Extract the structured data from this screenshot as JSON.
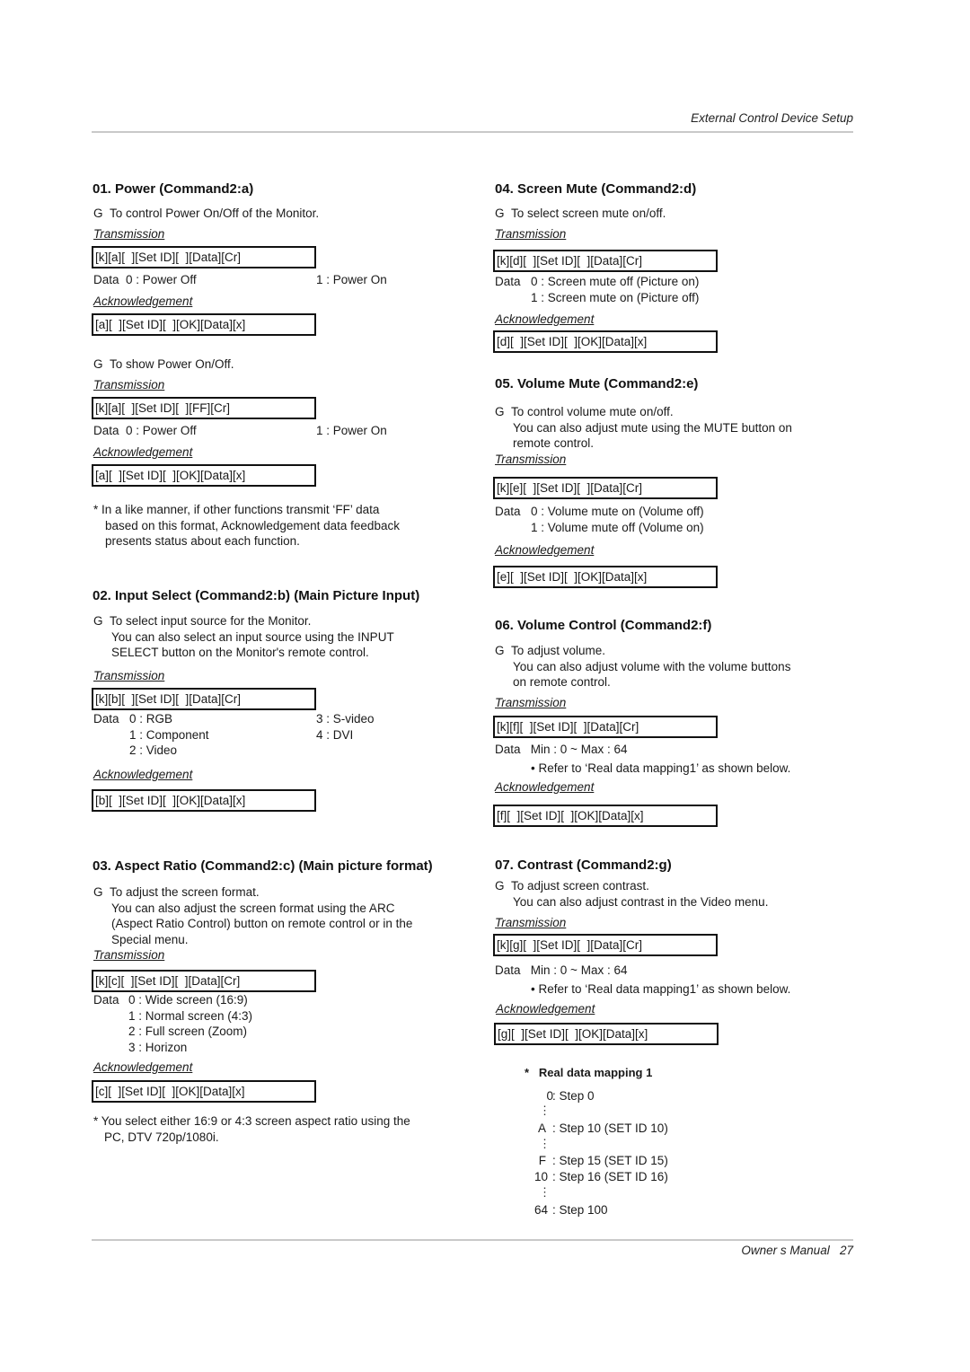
{
  "header": {
    "title": "External Control Device Setup"
  },
  "footer": {
    "label": "Owner s Manual",
    "page": "27"
  },
  "sections": {
    "s01": {
      "title": "01. Power (Command2:a)",
      "part1": {
        "bullet": "G",
        "desc": "To control Power On/Off of the Monitor.",
        "tx_label": "Transmission",
        "tx": "[k][a][  ][Set ID][  ][Data][Cr]",
        "data_label": "Data",
        "d0": "0  : Power Off",
        "d1": "1  : Power On",
        "ack_label": "Acknowledgement",
        "ack": "[a][  ][Set ID][  ][OK][Data][x]"
      },
      "part2": {
        "bullet": "G",
        "desc": "To show Power On/Off.",
        "tx_label": "Transmission",
        "tx": "[k][a][  ][Set ID][  ][FF][Cr]",
        "data_label": "Data",
        "d0": "0  : Power Off",
        "d1": "1  : Power On",
        "ack_label": "Acknowledgement",
        "ack": "[a][  ][Set ID][  ][OK][Data][x]"
      },
      "note": [
        "* In a like manner, if other functions transmit ‘FF’ data",
        "based on this format, Acknowledgement data feedback",
        "presents status about each function."
      ]
    },
    "s02": {
      "title": "02. Input Select (Command2:b) (Main Picture Input)",
      "bullet": "G",
      "desc": [
        "To select input source for the Monitor.",
        "You can also select an input source using the INPUT",
        "SELECT button on the Monitor's remote control."
      ],
      "tx_label": "Transmission",
      "tx": "[k][b][  ][Set ID][  ][Data][Cr]",
      "data_label": "Data",
      "left": [
        "0  : RGB",
        "1  : Component",
        "2  : Video"
      ],
      "right": [
        "3  : S-video",
        "4  : DVI"
      ],
      "ack_label": "Acknowledgement",
      "ack": "[b][  ][Set ID][  ][OK][Data][x]"
    },
    "s03": {
      "title": "03. Aspect Ratio (Command2:c) (Main picture format)",
      "bullet": "G",
      "desc": [
        "To adjust the screen format.",
        "You can also adjust the screen format using the ARC",
        "(Aspect Ratio Control) button on remote control or in the",
        "Special menu."
      ],
      "tx_label": "Transmission",
      "tx": "[k][c][  ][Set ID][  ][Data][Cr]",
      "data_label": "Data",
      "values": [
        "0  :  Wide screen (16:9)",
        "1  :  Normal screen (4:3)",
        "2  :  Full screen (Zoom)",
        "3  :  Horizon"
      ],
      "ack_label": "Acknowledgement",
      "ack": "[c][  ][Set ID][  ][OK][Data][x]",
      "note": [
        "* You select either 16:9 or 4:3 screen aspect ratio using the",
        "PC, DTV 720p/1080i."
      ]
    },
    "s04": {
      "title": "04. Screen Mute (Command2:d)",
      "bullet": "G",
      "desc": "To select screen mute on/off.",
      "tx_label": "Transmission",
      "tx": "[k][d][  ][Set ID][  ][Data][Cr]",
      "data_label": "Data",
      "values": [
        "0  :  Screen mute off (Picture on)",
        "1  :  Screen mute on (Picture off)"
      ],
      "ack_label": "Acknowledgement",
      "ack": "[d][  ][Set ID][  ][OK][Data][x]"
    },
    "s05": {
      "title": "05. Volume Mute (Command2:e)",
      "bullet": "G",
      "desc": [
        "To control volume mute on/off.",
        "You can also adjust mute using the MUTE button on",
        "remote control."
      ],
      "tx_label": "Transmission",
      "tx": "[k][e][  ][Set ID][  ][Data][Cr]",
      "data_label": "Data",
      "values": [
        "0  :  Volume mute on (Volume off)",
        "1  :  Volume mute off (Volume on)"
      ],
      "ack_label": "Acknowledgement",
      "ack": "[e][  ][Set ID][  ][OK][Data][x]"
    },
    "s06": {
      "title": "06. Volume Control (Command2:f)",
      "bullet": "G",
      "desc": [
        "To adjust volume.",
        "You can also adjust volume with the volume buttons",
        "on remote control."
      ],
      "tx_label": "Transmission",
      "tx": "[k][f][  ][Set ID][  ][Data][Cr]",
      "data_label": "Data",
      "range": "Min : 0 ~ Max : 64",
      "refer": "• Refer to ‘Real data mapping1’ as shown below.",
      "ack_label": "Acknowledgement",
      "ack": "[f][  ][Set ID][  ][OK][Data][x]"
    },
    "s07": {
      "title": "07. Contrast (Command2:g)",
      "bullet": "G",
      "desc": [
        "To adjust screen contrast.",
        "You can also adjust contrast in the Video menu."
      ],
      "tx_label": "Transmission",
      "tx": "[k][g][  ][Set ID][  ][Data][Cr]",
      "data_label": "Data",
      "range": "Min : 0 ~ Max : 64",
      "refer": "• Refer to ‘Real data mapping1’ as shown below.",
      "ack_label": "Acknowledgement",
      "ack": "[g][  ][Set ID][  ][OK][Data][x]"
    }
  },
  "mapping": {
    "star": "*",
    "title": "Real data mapping 1",
    "rows": [
      {
        "key": "0",
        "val": ": Step 0"
      },
      {
        "key": "A",
        "val": ": Step 10 (SET ID 10)"
      },
      {
        "key": "F",
        "val": ": Step 15 (SET ID 15)"
      },
      {
        "key": "10",
        "val": ": Step 16 (SET ID 16)"
      },
      {
        "key": "64",
        "val": ": Step 100"
      }
    ],
    "ellipsis": "⋮"
  }
}
